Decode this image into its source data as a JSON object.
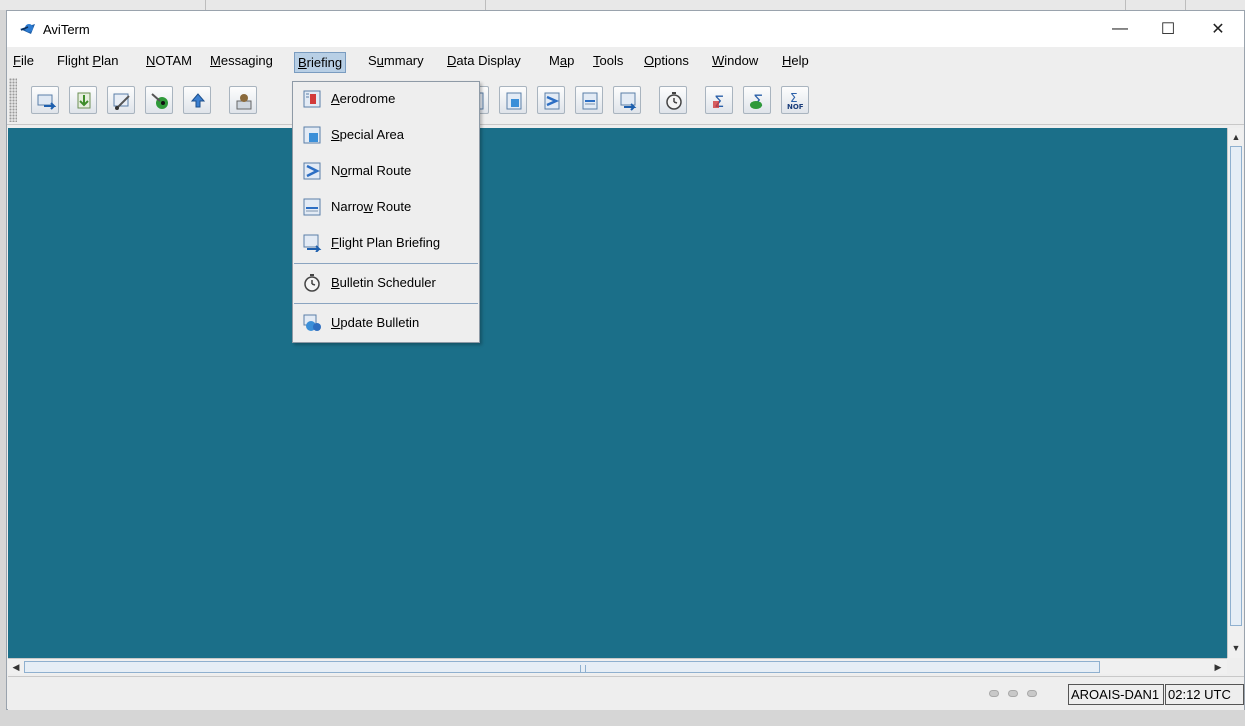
{
  "window": {
    "title": "AviTerm",
    "minimize_glyph": "—",
    "maximize_glyph": "☐",
    "close_glyph": "✕"
  },
  "menubar": {
    "items": [
      {
        "pre": "",
        "key": "F",
        "post": "ile"
      },
      {
        "pre": "Flight ",
        "key": "P",
        "post": "lan"
      },
      {
        "pre": "",
        "key": "N",
        "post": "OTAM"
      },
      {
        "pre": "",
        "key": "M",
        "post": "essaging"
      },
      {
        "pre": "",
        "key": "B",
        "post": "riefing"
      },
      {
        "pre": "S",
        "key": "u",
        "post": "mmary"
      },
      {
        "pre": "",
        "key": "D",
        "post": "ata Display"
      },
      {
        "pre": "M",
        "key": "a",
        "post": "p"
      },
      {
        "pre": "",
        "key": "T",
        "post": "ools"
      },
      {
        "pre": "",
        "key": "O",
        "post": "ptions"
      },
      {
        "pre": "",
        "key": "W",
        "post": "indow"
      },
      {
        "pre": "",
        "key": "H",
        "post": "elp"
      }
    ],
    "active": "Briefing"
  },
  "toolbar": {
    "icons": [
      "send-icon",
      "receive-icon",
      "edit-message-icon",
      "globe-icon",
      "upload-icon",
      "operator-icon",
      "aerodrome-briefing-icon",
      "special-area-icon",
      "normal-route-icon",
      "narrow-route-icon",
      "flight-plan-briefing-icon",
      "scheduler-icon",
      "summary-icon",
      "summary-green-icon",
      "nof-summary-icon"
    ],
    "nof_label": "NOF"
  },
  "briefing_menu": {
    "items": [
      {
        "pre": "",
        "key": "A",
        "post": "erodrome",
        "icon": "aerodrome-icon"
      },
      {
        "pre": "",
        "key": "S",
        "post": "pecial Area",
        "icon": "special-area-icon"
      },
      {
        "pre": "N",
        "key": "o",
        "post": "rmal Route",
        "icon": "normal-route-icon"
      },
      {
        "pre": "Narro",
        "key": "w",
        "post": " Route",
        "icon": "narrow-route-icon"
      },
      {
        "pre": "",
        "key": "F",
        "post": "light Plan Briefing",
        "icon": "flight-plan-briefing-icon"
      },
      {
        "pre": "",
        "key": "B",
        "post": "ulletin Scheduler",
        "icon": "stopwatch-icon"
      },
      {
        "pre": "",
        "key": "U",
        "post": "pdate Bulletin",
        "icon": "update-bulletin-icon"
      }
    ]
  },
  "status": {
    "station": "AROAIS-DAN1",
    "time": "02:12 UTC"
  },
  "colors": {
    "desktop": "#1b6f89",
    "menu_highlight": "#b8cfe5",
    "chrome": "#eeeeee"
  }
}
